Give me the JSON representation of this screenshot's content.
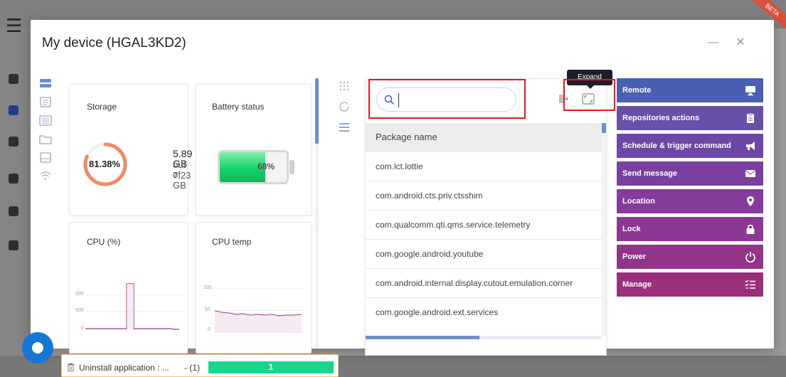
{
  "modal": {
    "title": "My device (HGAL3KD2)",
    "minimize_glyph": "—",
    "close_glyph": "✕"
  },
  "widgets": {
    "storage": {
      "title": "Storage",
      "percent_label": "81.38%",
      "percent": 81.38,
      "used": "5.89 GB",
      "out_of": "out of",
      "total": "7.23 GB",
      "ring_color": "#f08a62"
    },
    "battery": {
      "title": "Battery status",
      "percent_label": "68%",
      "percent": 68,
      "fill_color": "#13d36c"
    },
    "cpu": {
      "title": "CPU (%)",
      "ticks": [
        "000",
        "500",
        "0"
      ],
      "line_color": "#9b3a84"
    },
    "cpu_temp": {
      "title": "CPU temp",
      "ticks": [
        "100",
        "50",
        "0"
      ],
      "line_color": "#9b3a84"
    }
  },
  "packages": {
    "search_placeholder": "",
    "header": "Package name",
    "tooltip": "Expand",
    "rows": [
      "com.lct.lottie",
      "com.android.cts.priv.ctsshim",
      "com.qualcomm.qti.qms.service.telemetry",
      "com.google.android.youtube",
      "com.android.internal.display.cutout.emulation.corner",
      "com.google.android.ext.services"
    ]
  },
  "actions": [
    {
      "label": "Remote",
      "icon": "monitor-icon",
      "color": "#4a5fb2"
    },
    {
      "label": "Repositories actions",
      "icon": "clipboard-icon",
      "color": "#6a4fa8"
    },
    {
      "label": "Schedule & trigger command",
      "icon": "megaphone-icon",
      "color": "#6c47a5"
    },
    {
      "label": "Send message",
      "icon": "envelope-icon",
      "color": "#7b3f9f"
    },
    {
      "label": "Location",
      "icon": "map-pin-icon",
      "color": "#843c9c"
    },
    {
      "label": "Lock",
      "icon": "lock-icon",
      "color": "#8c3794"
    },
    {
      "label": "Power",
      "icon": "power-icon",
      "color": "#923589"
    },
    {
      "label": "Manage",
      "icon": "checklist-icon",
      "color": "#9a2f7c"
    }
  ],
  "notification": {
    "text": "Uninstall application : ...",
    "count": "- (1)",
    "progress_label": "1",
    "progress": 1.0
  },
  "background": {
    "beta": "BETA"
  }
}
